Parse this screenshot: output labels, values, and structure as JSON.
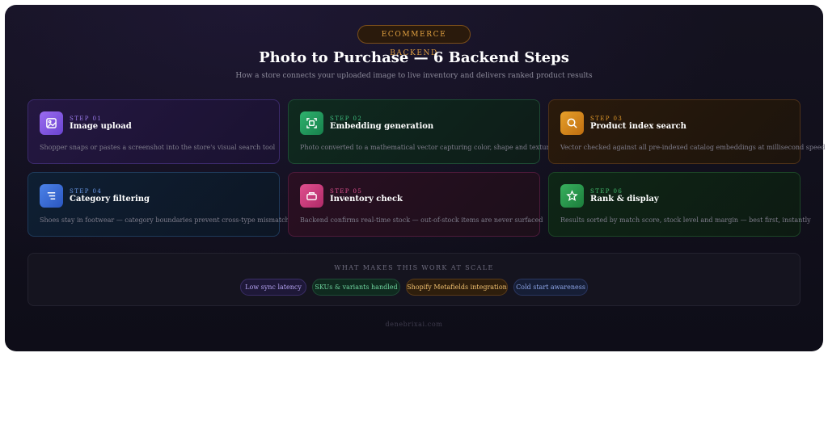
{
  "header": {
    "badge": "ECOMMERCE BACKEND",
    "title": "Photo to Purchase — 6 Backend Steps",
    "subtitle": "How a store connects your uploaded image to live inventory and delivers ranked product results"
  },
  "steps": [
    {
      "label": "STEP 01",
      "title": "Image upload",
      "desc": "Shopper snaps or pastes a screenshot into the store's visual search tool",
      "icon": "image-icon",
      "accent": "#9b7bea"
    },
    {
      "label": "STEP 02",
      "title": "Embedding generation",
      "desc": "Photo converted to a mathematical vector capturing color, shape and texture",
      "icon": "scan-icon",
      "accent": "#3fbf7f"
    },
    {
      "label": "STEP 03",
      "title": "Product index search",
      "desc": "Vector checked against all pre-indexed catalog embeddings at millisecond speed",
      "icon": "search-icon",
      "accent": "#e39a2a"
    },
    {
      "label": "STEP 04",
      "title": "Category filtering",
      "desc": "Shoes stay in footwear — category boundaries prevent cross-type mismatches",
      "icon": "filter-icon",
      "accent": "#6b9ae8"
    },
    {
      "label": "STEP 05",
      "title": "Inventory check",
      "desc": "Backend confirms real-time stock — out-of-stock items are never surfaced",
      "icon": "box-icon",
      "accent": "#e0508f"
    },
    {
      "label": "STEP 06",
      "title": "Rank & display",
      "desc": "Results sorted by match score, stock level and margin — best first, instantly",
      "icon": "star-icon",
      "accent": "#45c06f"
    }
  ],
  "scale": {
    "label": "WHAT MAKES THIS WORK AT SCALE",
    "chips": [
      "Low sync latency",
      "SKUs & variants handled",
      "Shopify Metafields integration",
      "Cold start awareness"
    ]
  },
  "footer": "denebrixai.com"
}
